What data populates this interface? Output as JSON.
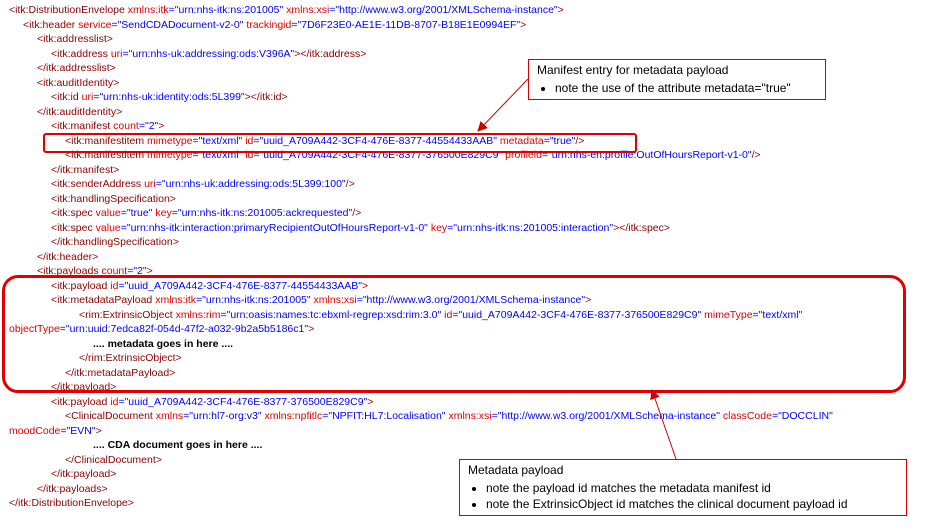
{
  "xml_lines": [
    {
      "indent": 0,
      "tokens": [
        [
          "t",
          "<itk:DistributionEnvelope "
        ],
        [
          "a",
          "xmlns:itk"
        ],
        [
          "v",
          "=\"urn:nhs-itk:ns:201005\" "
        ],
        [
          "a",
          "xmlns:xsi"
        ],
        [
          "v",
          "=\"http://www.w3.org/2001/XMLSchema-instance\""
        ],
        [
          "t",
          ">"
        ]
      ]
    },
    {
      "indent": 1,
      "tokens": [
        [
          "t",
          "<itk:header "
        ],
        [
          "a",
          "service"
        ],
        [
          "v",
          "=\"SendCDADocument-v2-0\" "
        ],
        [
          "a",
          "trackingid"
        ],
        [
          "v",
          "=\"7D6F23E0-AE1E-11DB-8707-B18E1E0994EF\""
        ],
        [
          "t",
          ">"
        ]
      ]
    },
    {
      "indent": 2,
      "tokens": [
        [
          "t",
          "<itk:addresslist>"
        ]
      ]
    },
    {
      "indent": 3,
      "tokens": [
        [
          "t",
          "<itk:address "
        ],
        [
          "a",
          "uri"
        ],
        [
          "v",
          "=\"urn:nhs-uk:addressing:ods:V396A\""
        ],
        [
          "t",
          "></itk:address>"
        ]
      ]
    },
    {
      "indent": 2,
      "tokens": [
        [
          "t",
          "</itk:addresslist>"
        ]
      ]
    },
    {
      "indent": 2,
      "tokens": [
        [
          "t",
          "<itk:auditIdentity>"
        ]
      ]
    },
    {
      "indent": 3,
      "tokens": [
        [
          "t",
          "<itk:id "
        ],
        [
          "a",
          "uri"
        ],
        [
          "v",
          "=\"urn:nhs-uk:identity:ods:5L399\""
        ],
        [
          "t",
          "></itk:id>"
        ]
      ]
    },
    {
      "indent": 2,
      "tokens": [
        [
          "t",
          "</itk:auditIdentity>"
        ]
      ]
    },
    {
      "indent": 3,
      "tokens": [
        [
          "t",
          "<itk:manifest "
        ],
        [
          "a",
          "count"
        ],
        [
          "v",
          "=\"2\""
        ],
        [
          "t",
          ">"
        ]
      ]
    },
    {
      "indent": 4,
      "tokens": [
        [
          "t",
          "<itk:manifestitem "
        ],
        [
          "a",
          "mimetype"
        ],
        [
          "v",
          "=\"text/xml\" "
        ],
        [
          "a",
          "id"
        ],
        [
          "v",
          "=\"uuid_A709A442-3CF4-476E-8377-44554433AAB\" "
        ],
        [
          "a",
          "metadata"
        ],
        [
          "v",
          "=\"true\""
        ],
        [
          "t",
          "/>"
        ]
      ]
    },
    {
      "indent": 4,
      "tokens": [
        [
          "t",
          "<itk:manifestitem "
        ],
        [
          "a",
          "mimetype"
        ],
        [
          "v",
          "=\"text/xml\" "
        ],
        [
          "a",
          "id"
        ],
        [
          "v",
          "=\"uuid_A709A442-3CF4-476E-8377-376500E829C9\" "
        ],
        [
          "a",
          "profileid"
        ],
        [
          "v",
          "=\"urn:nhs-en:profile:OutOfHoursReport-v1-0\""
        ],
        [
          "t",
          "/>"
        ]
      ]
    },
    {
      "indent": 3,
      "tokens": [
        [
          "t",
          "</itk:manifest>"
        ]
      ]
    },
    {
      "indent": 3,
      "tokens": [
        [
          "t",
          "<itk:senderAddress "
        ],
        [
          "a",
          "uri"
        ],
        [
          "v",
          "=\"urn:nhs-uk:addressing:ods:5L399:100\""
        ],
        [
          "t",
          "/>"
        ]
      ]
    },
    {
      "indent": 3,
      "tokens": [
        [
          "t",
          "<itk:handlingSpecification>"
        ]
      ]
    },
    {
      "indent": 3,
      "tokens": [
        [
          "t",
          "<itk:spec "
        ],
        [
          "a",
          "value"
        ],
        [
          "v",
          "=\"true\" "
        ],
        [
          "a",
          "key"
        ],
        [
          "v",
          "=\"urn:nhs-itk:ns:201005:ackrequested\""
        ],
        [
          "t",
          "/>"
        ]
      ]
    },
    {
      "indent": 3,
      "tokens": [
        [
          "t",
          "<itk:spec "
        ],
        [
          "a",
          "value"
        ],
        [
          "v",
          "=\"urn:nhs-itk:interaction:primaryRecipientOutOfHoursReport-v1-0\" "
        ],
        [
          "a",
          "key"
        ],
        [
          "v",
          "=\"urn:nhs-itk:ns:201005:interaction\""
        ],
        [
          "t",
          "></itk:spec>"
        ]
      ]
    },
    {
      "indent": 3,
      "tokens": [
        [
          "t",
          "</itk:handlingSpecification>"
        ]
      ]
    },
    {
      "indent": 2,
      "tokens": [
        [
          "t",
          "</itk:header>"
        ]
      ]
    },
    {
      "indent": 2,
      "tokens": [
        [
          "t",
          "<itk:payloads "
        ],
        [
          "a",
          "count"
        ],
        [
          "v",
          "=\"2\""
        ],
        [
          "t",
          ">"
        ]
      ]
    },
    {
      "indent": 3,
      "tokens": [
        [
          "t",
          "<itk:payload "
        ],
        [
          "a",
          "id"
        ],
        [
          "v",
          "=\"uuid_A709A442-3CF4-476E-8377-44554433AAB\""
        ],
        [
          "t",
          ">"
        ]
      ]
    },
    {
      "indent": 3,
      "tokens": [
        [
          "t",
          "<itk:metadataPayload "
        ],
        [
          "a",
          "xmlns:itk"
        ],
        [
          "v",
          "=\"urn:nhs-itk:ns:201005\" "
        ],
        [
          "a",
          "xmlns:xsi"
        ],
        [
          "v",
          "=\"http://www.w3.org/2001/XMLSchema-instance\""
        ],
        [
          "t",
          ">"
        ]
      ]
    },
    {
      "indent": 5,
      "tokens": [
        [
          "t",
          "<rim:ExtrinsicObject "
        ],
        [
          "a",
          "xmlns:rim"
        ],
        [
          "v",
          "=\"urn:oasis:names:tc:ebxml-regrep:xsd:rim:3.0\" "
        ],
        [
          "a",
          "id"
        ],
        [
          "v",
          "=\"uuid_A709A442-3CF4-476E-8377-376500E829C9\" "
        ],
        [
          "a",
          "mimeType"
        ],
        [
          "v",
          "=\"text/xml\""
        ]
      ]
    },
    {
      "indent": 0,
      "tokens": [
        [
          "a",
          "objectType"
        ],
        [
          "v",
          "=\"urn:uuid:7edca82f-054d-47f2-a032-9b2a5b5186c1\""
        ],
        [
          "t",
          ">"
        ]
      ]
    },
    {
      "indent": 6,
      "tokens": [
        [
          "bold",
          ".... metadata goes in here ...."
        ]
      ]
    },
    {
      "indent": 5,
      "tokens": [
        [
          "t",
          "</rim:ExtrinsicObject>"
        ]
      ]
    },
    {
      "indent": 4,
      "tokens": [
        [
          "t",
          "</itk:metadataPayload>"
        ]
      ]
    },
    {
      "indent": 3,
      "tokens": [
        [
          "t",
          "</itk:payload>"
        ]
      ]
    },
    {
      "indent": 3,
      "tokens": [
        [
          "t",
          "<itk:payload "
        ],
        [
          "a",
          "id"
        ],
        [
          "v",
          "=\"uuid_A709A442-3CF4-476E-8377-376500E829C9\""
        ],
        [
          "t",
          ">"
        ]
      ]
    },
    {
      "indent": 4,
      "tokens": [
        [
          "t",
          "<ClinicalDocument "
        ],
        [
          "a",
          "xmlns"
        ],
        [
          "v",
          "=\"urn:hl7-org:v3\" "
        ],
        [
          "a",
          "xmlns:npfitlc"
        ],
        [
          "v",
          "=\"NPFIT:HL7:Localisation\" "
        ],
        [
          "a",
          "xmlns:xsi"
        ],
        [
          "v",
          "=\"http://www.w3.org/2001/XMLSchema-instance\" "
        ],
        [
          "a",
          "classCode"
        ],
        [
          "v",
          "=\"DOCCLIN\""
        ]
      ]
    },
    {
      "indent": 0,
      "tokens": [
        [
          "a",
          "moodCode"
        ],
        [
          "v",
          "=\"EVN\""
        ],
        [
          "t",
          ">"
        ]
      ]
    },
    {
      "indent": 6,
      "tokens": [
        [
          "bold",
          ".... CDA document goes in here ...."
        ]
      ]
    },
    {
      "indent": 4,
      "tokens": [
        [
          "t",
          "</ClinicalDocument>"
        ]
      ]
    },
    {
      "indent": 3,
      "tokens": [
        [
          "t",
          "</itk:payload>"
        ]
      ]
    },
    {
      "indent": 2,
      "tokens": [
        [
          "t",
          "</itk:payloads>"
        ]
      ]
    },
    {
      "indent": 0,
      "tokens": [
        [
          "t",
          "</itk:DistributionEnvelope>"
        ]
      ]
    }
  ],
  "callouts": {
    "manifest": {
      "title": "Manifest entry for metadata payload",
      "bullets": [
        "note the use of the attribute metadata=\"true\""
      ]
    },
    "payload": {
      "title": "Metadata payload",
      "bullets": [
        "note the payload id matches the metadata manifest id",
        "note the ExtrinsicObject id matches the clinical document payload id"
      ]
    }
  },
  "colors": {
    "tag": "#8b0000",
    "attribute": "#e00000",
    "value": "#0000ff",
    "highlight": "#e00000"
  }
}
